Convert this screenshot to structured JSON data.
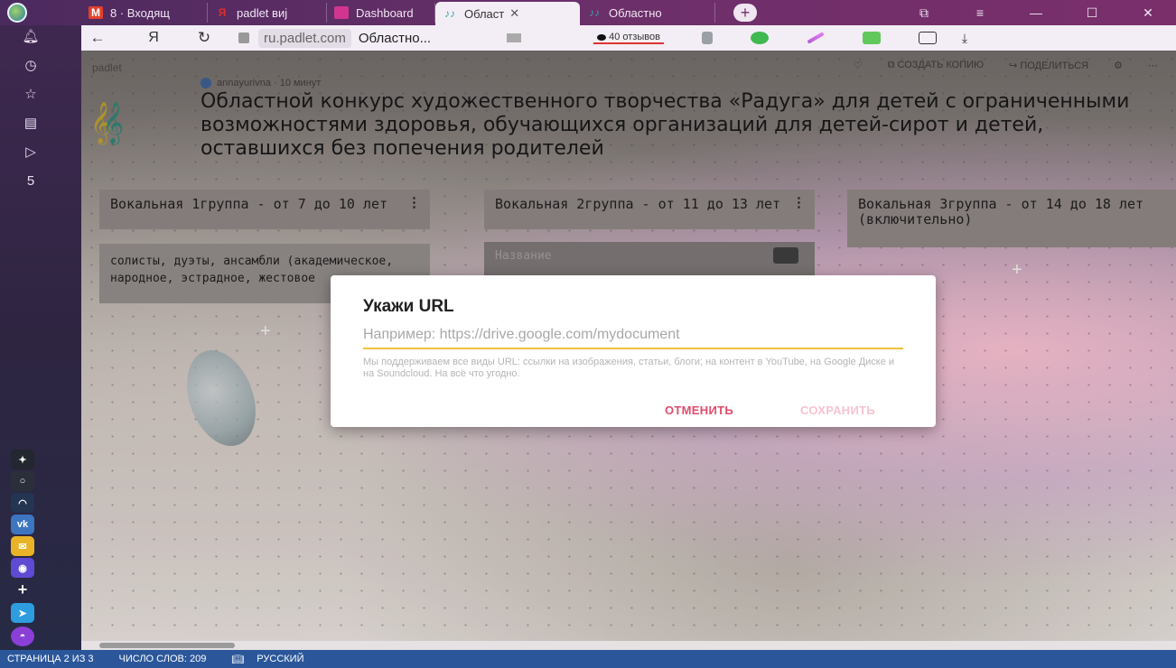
{
  "browser": {
    "tabs": [
      {
        "label": "8 · Входящ",
        "icon": "gmail-icon",
        "color": "#e2412d"
      },
      {
        "label": "padlet виј",
        "icon": "yandex-icon",
        "color": "#e02b2b"
      },
      {
        "label": "Dashboard",
        "icon": "dashboard-icon",
        "color": "#d0368f"
      },
      {
        "label": "Област",
        "icon": "padlet-icon",
        "color": "#3aa6a0",
        "active": true
      },
      {
        "label": "Областно",
        "icon": "padlet-icon",
        "color": "#3aa6a0"
      }
    ],
    "back": "←",
    "yandex": "Я",
    "reload": "↻",
    "domain": "ru.padlet.com",
    "page_title": "Областно...",
    "reviews": "40 отзывов"
  },
  "padlet": {
    "brand": "padlet",
    "actions": [
      "♡",
      "⧉ СОЗДАТЬ КОПИЮ",
      "↪ ПОДЕЛИТЬСЯ",
      "⚙",
      "⋯"
    ],
    "author": "annayurivna · 10 минут",
    "title": "Областной конкурс художественного творчества «Радуга» для детей с ограниченными возможностями здоровья, обучающихся организаций для детей-сирот и детей, оставшихся без попечения родителей",
    "columns": [
      {
        "title": "Вокальная 1группа - от 7 до 10 лет"
      },
      {
        "title": "Вокальная 2группа - от 11 до 13 лет"
      },
      {
        "title": "Вокальная 3группа - от 14 до 18 лет (включительно)"
      }
    ],
    "card1_text": "солисты, дуэты, ансамбли (академическое, народное, эстрадное, жестовое",
    "card2_placeholder": "Название"
  },
  "dialog": {
    "title": "Укажи URL",
    "placeholder": "Например: https://drive.google.com/mydocument",
    "value": "",
    "help": "Мы поддерживаем все виды URL: ссылки на изображения, статьи, блоги; на контент в YouTube, на Google Диске и на Soundcloud. На всё что угодно.",
    "cancel": "ОТМЕНИТЬ",
    "save": "СОХРАНИТЬ"
  },
  "statusbar": {
    "page": "СТРАНИЦА 2 ИЗ 3",
    "words": "ЧИСЛО СЛОВ: 209",
    "language": "РУССКИЙ"
  }
}
